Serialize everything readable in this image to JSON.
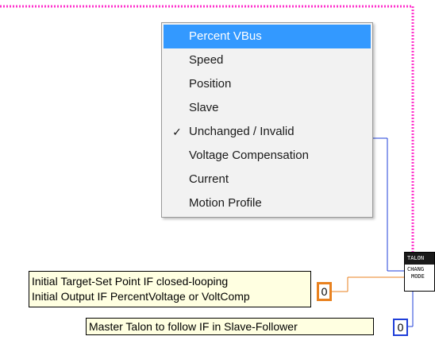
{
  "menu": {
    "items": [
      {
        "label": "Percent VBus",
        "selected": true,
        "checked": false
      },
      {
        "label": "Speed",
        "selected": false,
        "checked": false
      },
      {
        "label": "Position",
        "selected": false,
        "checked": false
      },
      {
        "label": "Slave",
        "selected": false,
        "checked": false
      },
      {
        "label": "Unchanged / Invalid",
        "selected": false,
        "checked": true
      },
      {
        "label": "Voltage Compensation",
        "selected": false,
        "checked": false
      },
      {
        "label": "Current",
        "selected": false,
        "checked": false
      },
      {
        "label": "Motion Profile",
        "selected": false,
        "checked": false
      }
    ],
    "check_glyph": "✓"
  },
  "talon_block": {
    "title": "TALON",
    "subtitle_line1": "CHANG",
    "subtitle_line2": "MODE"
  },
  "comments": {
    "target_line1": "Initial Target-Set Point IF closed-looping",
    "target_line2": "Initial Output IF PercentVoltage or VoltComp",
    "master": "Master Talon to follow IF in Slave-Follower"
  },
  "constants": {
    "target_value": "0",
    "master_value": "0"
  },
  "colors": {
    "magenta_wire": "#ff33cc",
    "blue_wire": "#1f3fd9",
    "orange_wire": "#e8811f",
    "menu_highlight": "#3399ff",
    "comment_bg": "#ffffe1"
  }
}
